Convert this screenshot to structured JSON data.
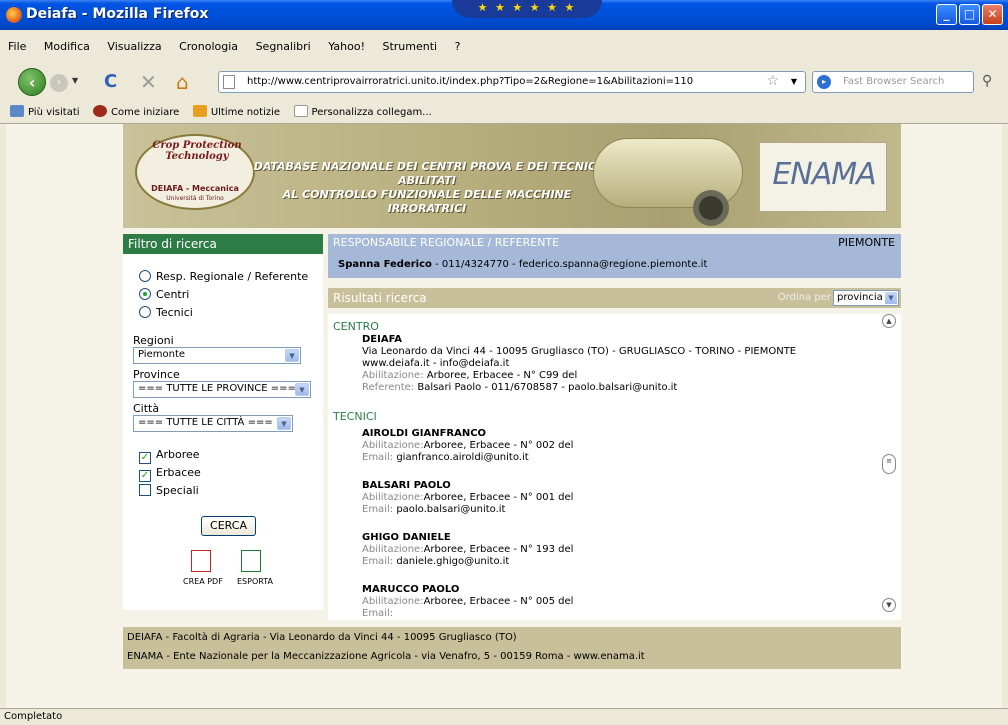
{
  "window": {
    "title": "Deiafa - Mozilla Firefox",
    "flag": "★ ★ ★ ★ ★ ★"
  },
  "menu": [
    "File",
    "Modifica",
    "Visualizza",
    "Cronologia",
    "Segnalibri",
    "Yahoo!",
    "Strumenti",
    "?"
  ],
  "nav": {
    "url": "http://www.centriprovairroratrici.unito.it/index.php?Tipo=2&Regione=1&Abilitazioni=110",
    "search_placeholder": "Fast Browser Search"
  },
  "bookmarks": [
    "Più visitati",
    "Come iniziare",
    "Ultime notizie",
    "Personalizza collegam..."
  ],
  "bookmark_colors": [
    "#5b88c8",
    "#a02a18",
    "#e8a020",
    "#ffffff"
  ],
  "banner": {
    "logo_arc": "Crop Protection Technology",
    "logo_name": "DEIAFA - Meccanica",
    "logo_uni": "Università di Torino",
    "line1": "DATABASE NAZIONALE DEI CENTRI PROVA E DEI TECNICI ABILITATI",
    "line2": "AL CONTROLLO FUNZIONALE DELLE MACCHINE IRRORATRICI",
    "enama": "ENAMA"
  },
  "filter": {
    "title": "Filtro di ricerca",
    "radios": [
      {
        "label": "Resp. Regionale / Referente",
        "checked": false
      },
      {
        "label": "Centri",
        "checked": true
      },
      {
        "label": "Tecnici",
        "checked": false
      }
    ],
    "regioni_label": "Regioni",
    "regioni_value": "Piemonte",
    "province_label": "Province",
    "province_value": "=== TUTTE LE PROVINCE ===",
    "citta_label": "Città",
    "citta_value": "=== TUTTE LE CITTÀ ===",
    "checks": [
      {
        "label": "Arboree",
        "checked": true
      },
      {
        "label": "Erbacee",
        "checked": true
      },
      {
        "label": "Speciali",
        "checked": false
      }
    ],
    "search_button": "CERCA",
    "pdf_label": "CREA PDF",
    "export_label": "ESPORTA"
  },
  "responsabile": {
    "title": "RESPONSABILE REGIONALE / REFERENTE",
    "region": "PIEMONTE",
    "name": "Spanna Federico",
    "details": " - 011/4324770 - federico.spanna@regione.piemonte.it"
  },
  "results": {
    "title": "Risultati ricerca",
    "order_label": "Ordina per",
    "order_value": "provincia",
    "centro_heading": "CENTRO",
    "centro": {
      "name": "DEIAFA",
      "address": "Via Leonardo da Vinci 44 - 10095 Grugliasco (TO) - GRUGLIASCO - TORINO - PIEMONTE",
      "web": "www.deiafa.it - info@deiafa.it",
      "abil_key": "Abilitazione:",
      "abil_val": " Arboree, Erbacee - N° C99 del",
      "ref_key": "Referente:",
      "ref_val": " Balsari Paolo - 011/6708587 - paolo.balsari@unito.it"
    },
    "tecnici_heading": "TECNICI",
    "tecnici": [
      {
        "name": "AIROLDI GIANFRANCO",
        "abil": "Arboree, Erbacee - N° 002 del",
        "email": "gianfranco.airoldi@unito.it"
      },
      {
        "name": "BALSARI PAOLO",
        "abil": "Arboree, Erbacee - N° 001 del",
        "email": "paolo.balsari@unito.it"
      },
      {
        "name": "GHIGO DANIELE",
        "abil": "Arboree, Erbacee - N° 193 del",
        "email": "daniele.ghigo@unito.it"
      },
      {
        "name": "MARUCCO PAOLO",
        "abil": "Arboree, Erbacee - N° 005 del",
        "email": ""
      }
    ],
    "abil_key": "Abilitazione:",
    "email_key": "Email:"
  },
  "footer": {
    "line1": "DEIAFA - Facoltà di Agraria - Via Leonardo da Vinci 44 - 10095 Grugliasco (TO)",
    "line2": "ENAMA - Ente Nazionale per la Meccanizzazione Agricola - via Venafro, 5 - 00159 Roma - www.enama.it"
  },
  "status": "Completato"
}
